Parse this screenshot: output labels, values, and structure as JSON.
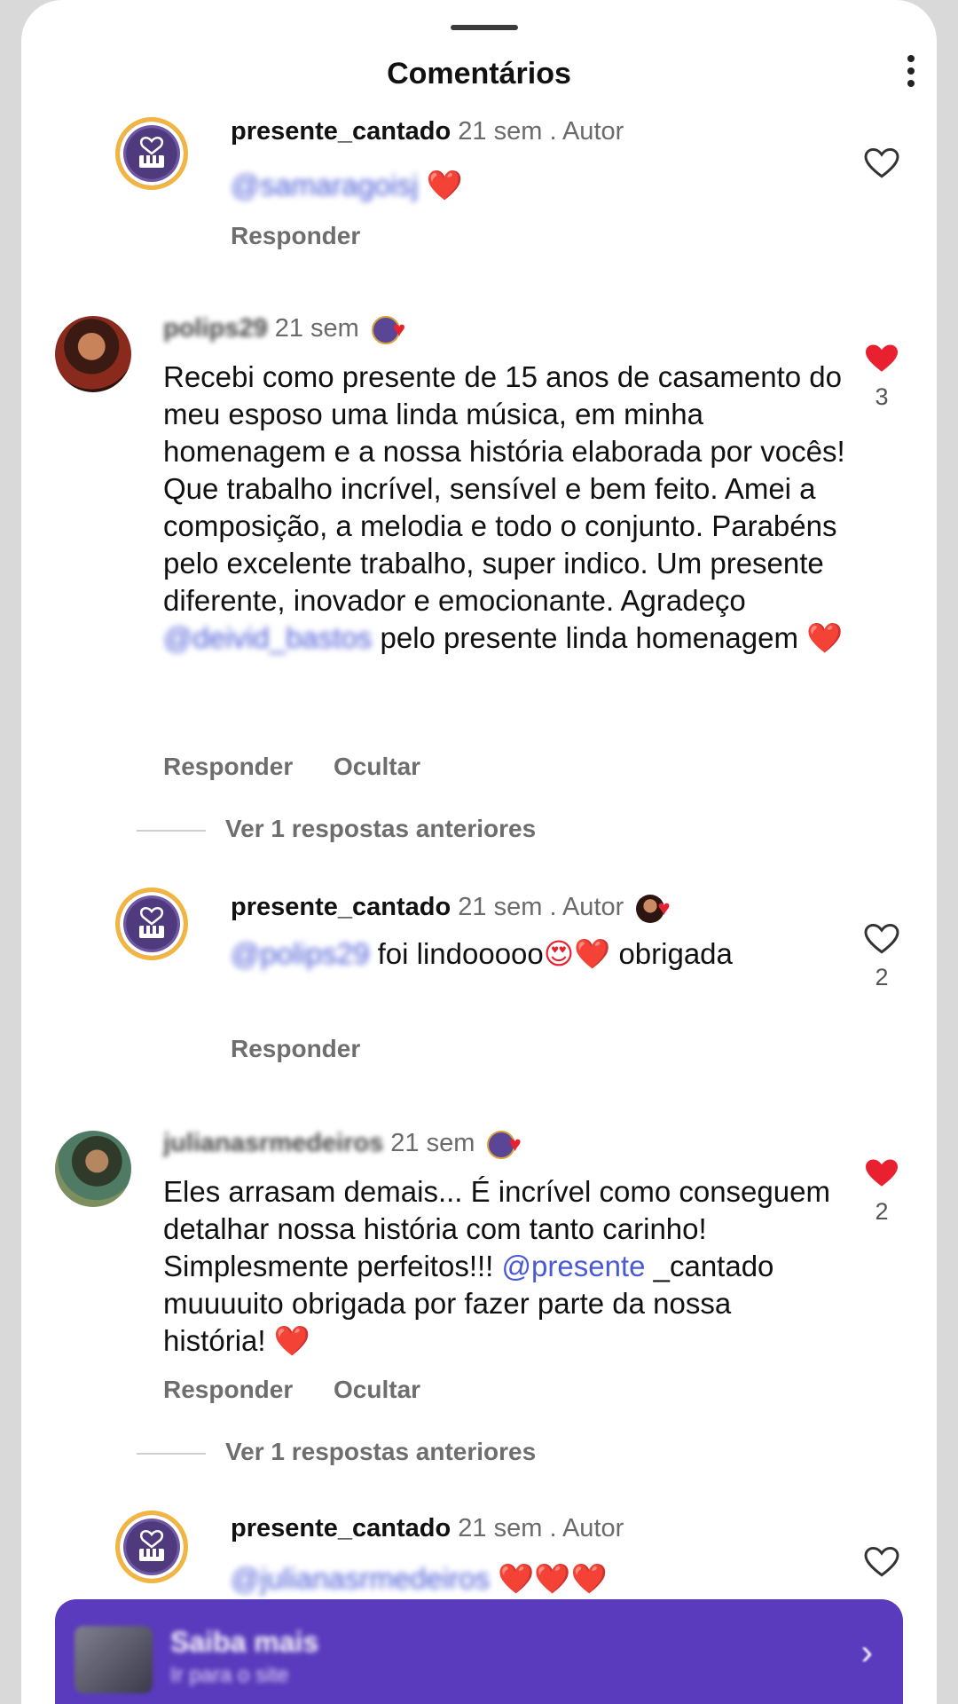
{
  "header": {
    "title": "Comentários",
    "menu_icon": "more-vertical-icon"
  },
  "comments": [
    {
      "username": "presente_cantado",
      "time": "21 sem",
      "sep": ".",
      "author": "Autor",
      "mention": "@samaragoisj",
      "text": "",
      "emoji": "❤️",
      "actions": [
        "Responder"
      ],
      "likes": ""
    },
    {
      "username": "polips29",
      "time": "21 sem",
      "text": "Recebi como presente de 15 anos de casamento do meu esposo uma linda música, em minha homenagem e a nossa história elaborada por vocês! Que trabalho incrível, sensível e bem feito. Amei a composição, a melodia e todo o conjunto. Parabéns pelo excelente trabalho, super indico. Um presente diferente, inovador e emocionante. Agradeço",
      "mention": "@deivid_bastos",
      "text_after": "pelo presente linda homenagem",
      "emoji": "❤️",
      "actions": [
        "Responder",
        "Ocultar"
      ],
      "likes": "3"
    },
    {
      "username": "presente_cantado",
      "time": "21 sem",
      "sep": ".",
      "author": "Autor",
      "mention": "@polips29",
      "text": "foi lindooooo",
      "emoji": "😍❤️",
      "text_after": "obrigada",
      "actions": [
        "Responder"
      ],
      "likes": "2"
    },
    {
      "username": "julianasrmedeiros",
      "time": "21 sem",
      "text": "Eles arrasam demais... É  incrível como conseguem detalhar nossa história com tanto carinho! Simplesmente  perfeitos!!!",
      "mention": "@presente",
      "text_after": "_cantado  muuuuito obrigada por fazer parte da nossa história!",
      "emoji": "❤️",
      "actions": [
        "Responder",
        "Ocultar"
      ],
      "likes": "2"
    },
    {
      "username": "presente_cantado",
      "time": "21 sem",
      "sep": ".",
      "author": "Autor",
      "mention": "@julianasrmedeiros",
      "emoji": "❤️❤️❤️",
      "actions": [],
      "likes": ""
    }
  ],
  "view_previous": "Ver 1 respostas anteriores",
  "ad": {
    "title": "Saiba mais",
    "subtitle": "Ir para o site",
    "chevron": "›"
  },
  "colors": {
    "like_red": "#e9202f",
    "mention": "#4a5ad6",
    "ad_purple": "#5a3bbd",
    "muted": "#6e6e6e"
  }
}
